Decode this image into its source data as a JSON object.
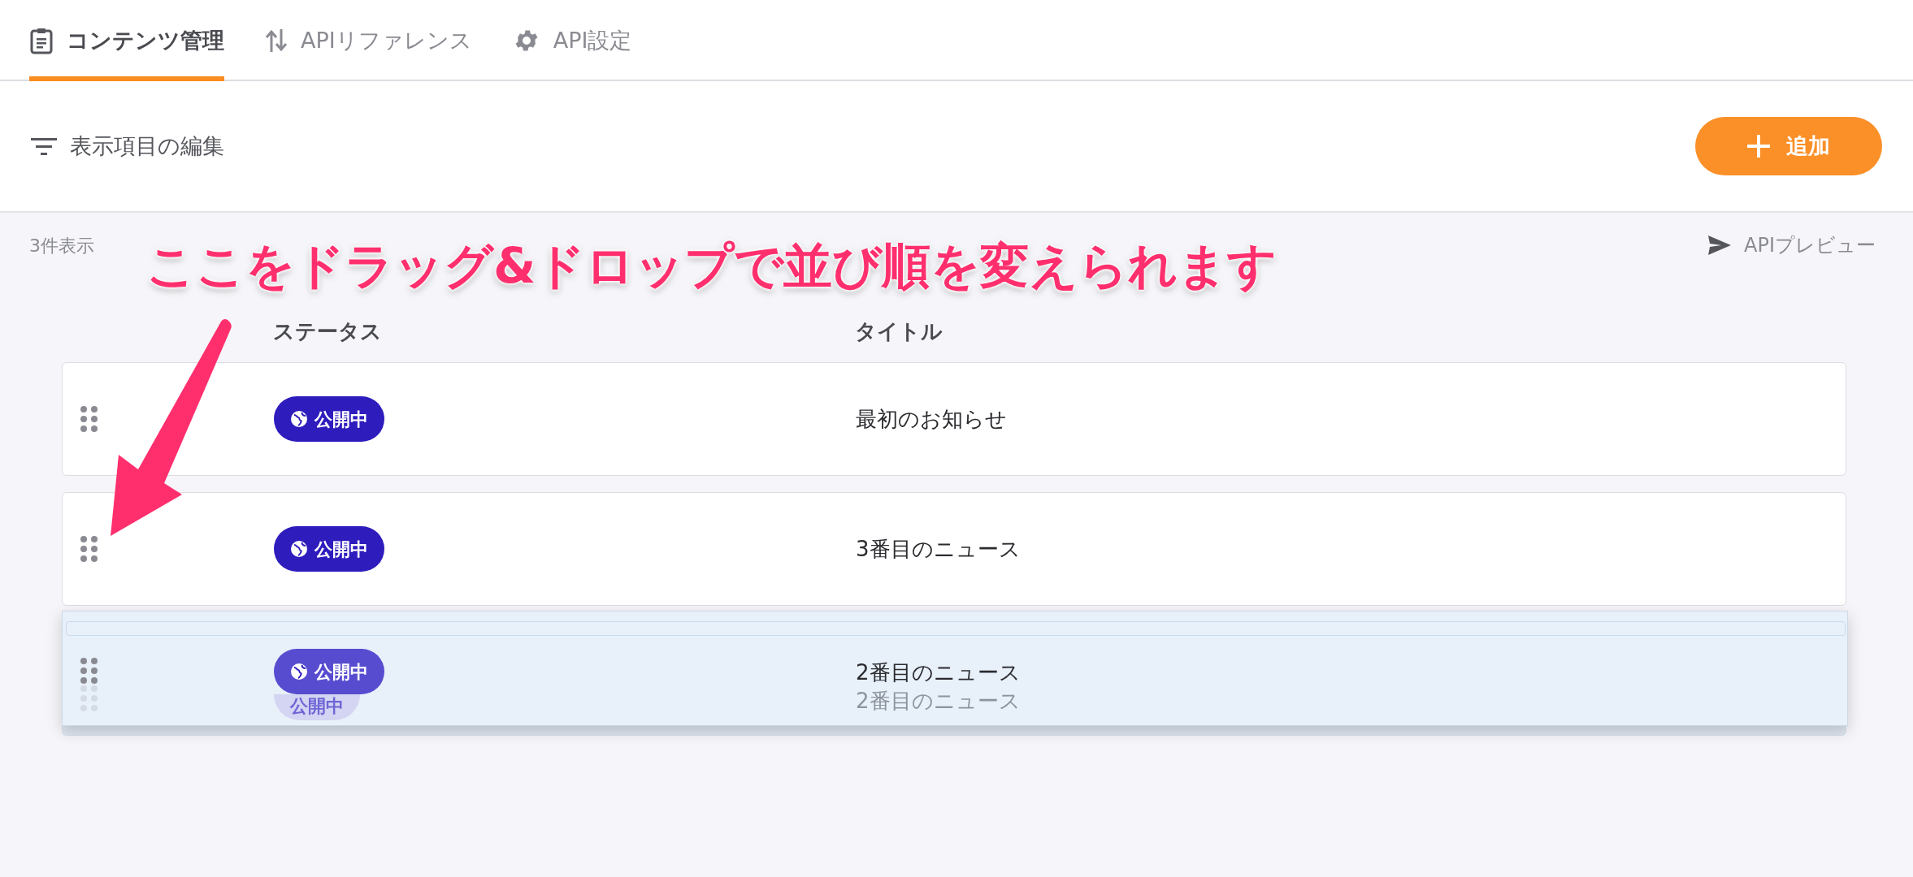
{
  "tabs": [
    {
      "label": "コンテンツ管理",
      "selected": true
    },
    {
      "label": "APIリファレンス",
      "selected": false
    },
    {
      "label": "API設定",
      "selected": false
    }
  ],
  "toolbar": {
    "edit_columns": "表示項目の編集",
    "add_button": "追加"
  },
  "count": "3件表示",
  "api_preview": "APIプレビュー",
  "callout": "ここをドラッグ&ドロップで並び順を変えられます",
  "table": {
    "columns": [
      "ステータス",
      "タイトル"
    ],
    "rows": [
      {
        "kind": "normal",
        "status": "公開中",
        "title": "最初のお知らせ"
      },
      {
        "kind": "normal",
        "status": "公開中",
        "title": "3番目のニュース"
      },
      {
        "kind": "ghost",
        "status": "公開中",
        "title": "2番目のニュース"
      }
    ],
    "drag_preview": {
      "status": "公開中",
      "title": "2番目のニュース"
    }
  }
}
